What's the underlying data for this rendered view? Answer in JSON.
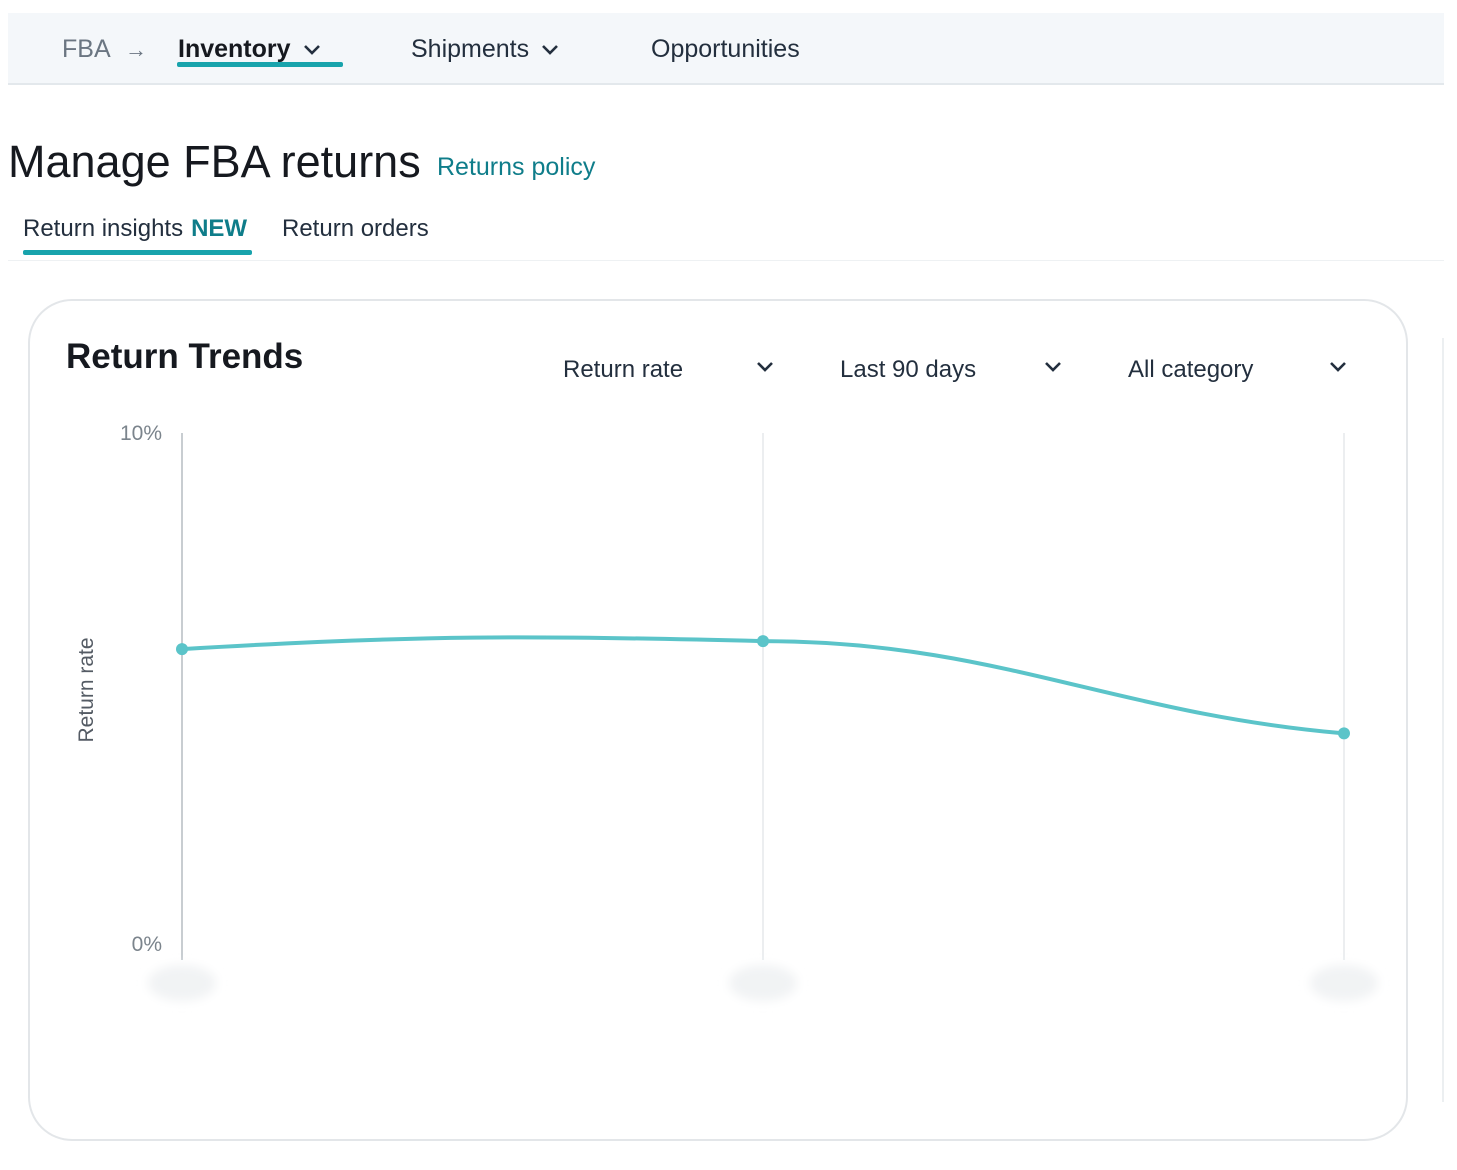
{
  "nav": {
    "root": "FBA",
    "items": [
      {
        "label": "Inventory",
        "active": true
      },
      {
        "label": "Shipments"
      },
      {
        "label": "Opportunities"
      }
    ]
  },
  "page": {
    "title": "Manage FBA returns",
    "policy_link": "Returns policy"
  },
  "tabs": [
    {
      "label": "Return insights",
      "badge": "NEW",
      "active": true
    },
    {
      "label": "Return orders"
    }
  ],
  "card": {
    "title": "Return Trends",
    "filters": {
      "metric": "Return rate",
      "range": "Last 90 days",
      "category": "All category"
    }
  },
  "colors": {
    "accent": "#18a3ac",
    "line": "#5bc4c9",
    "link": "#0f7d8a"
  },
  "chart_data": {
    "type": "line",
    "ylabel": "Return rate",
    "ylim": [
      0,
      10
    ],
    "y_ticks": [
      "0%",
      "10%"
    ],
    "x": [
      0,
      1,
      2
    ],
    "series": [
      {
        "values": [
          5.9,
          6.05,
          4.3
        ]
      }
    ],
    "grid": "vertical"
  }
}
